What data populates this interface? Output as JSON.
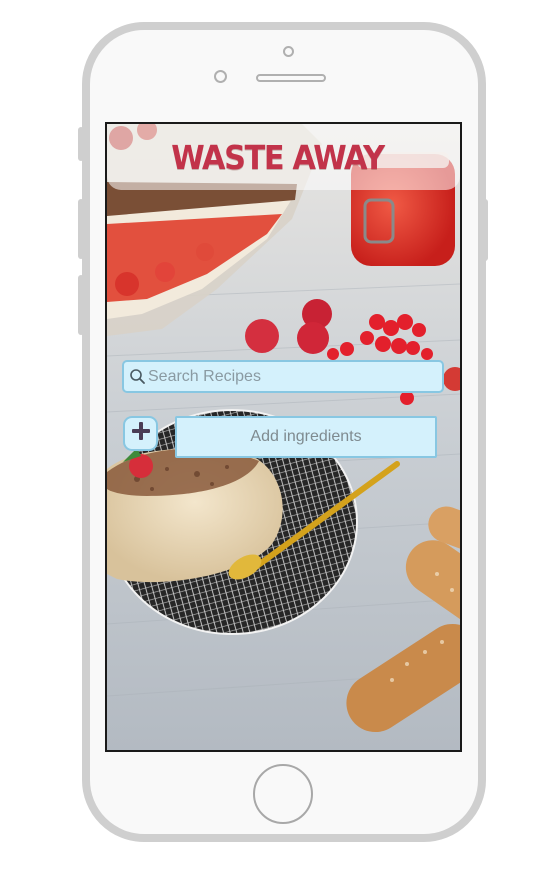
{
  "app": {
    "title": "WASTE AWAY"
  },
  "search": {
    "placeholder": "Search Recipes",
    "icon": "search-icon"
  },
  "ingredients": {
    "add_icon": "plus-icon",
    "label": "Add ingredients"
  },
  "colors": {
    "brand_red": "#c2334a",
    "field_background": "#d4f1fc",
    "field_border": "#88c7e2",
    "device_frame": "#cfcfcf"
  }
}
